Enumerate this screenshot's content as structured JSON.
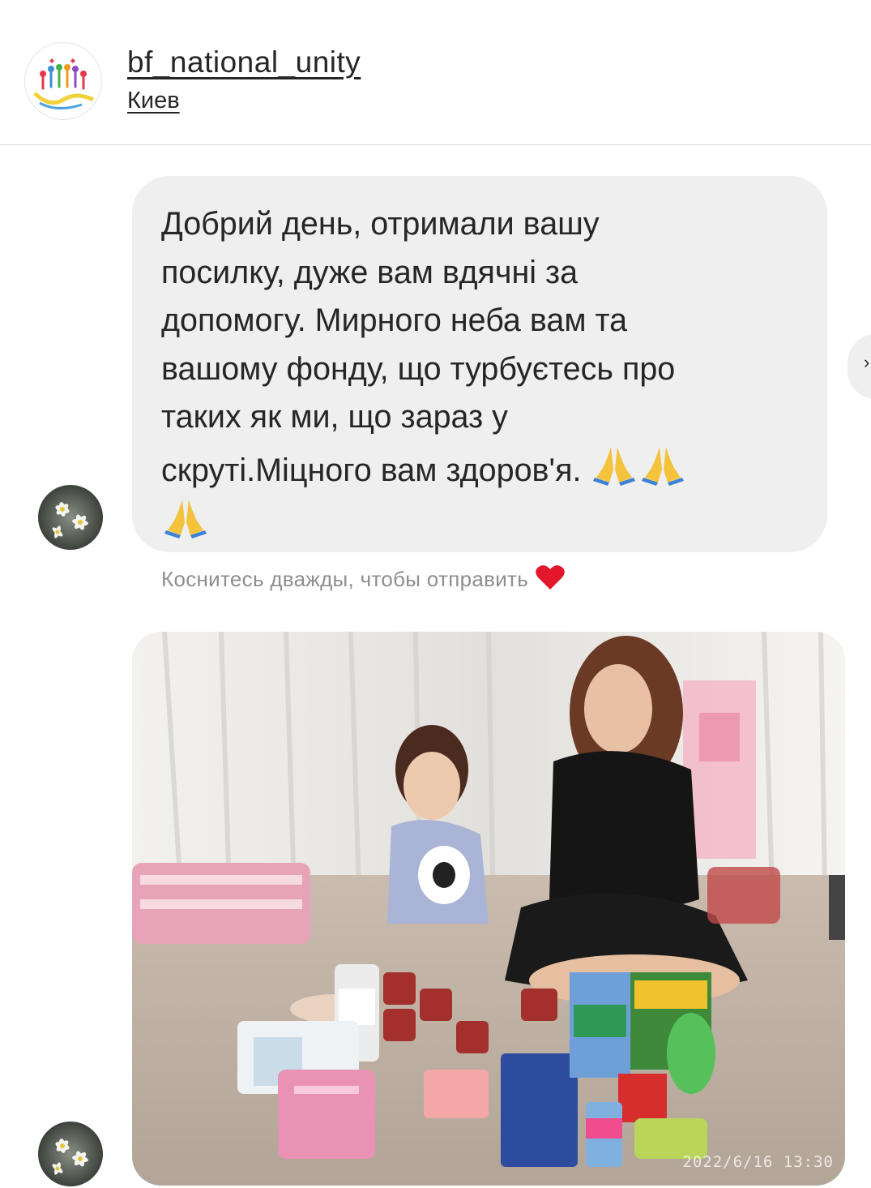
{
  "header": {
    "username": "bf_national_unity",
    "location": "Киев",
    "avatar_icon": "charity-logo-icon"
  },
  "message": {
    "text": "Добрий день, отримали вашу\nпосилку, дуже вам вдячні за\nдопомогу. Мирного неба вам та\nвашому фонду, що турбуєтесь про\nтаких як ми, що зараз у\nскруті.Міцного вам здоров'я. ",
    "emoji": "praying-hands-icon"
  },
  "hint": {
    "text": "Коснитесь дважды, чтобы отправить",
    "icon": "red-heart-icon"
  },
  "photo": {
    "timestamp": "2022/6/16 13:30",
    "description_icon": "photo-attachment"
  },
  "sender_avatar_icon": "daisy-avatar-icon"
}
